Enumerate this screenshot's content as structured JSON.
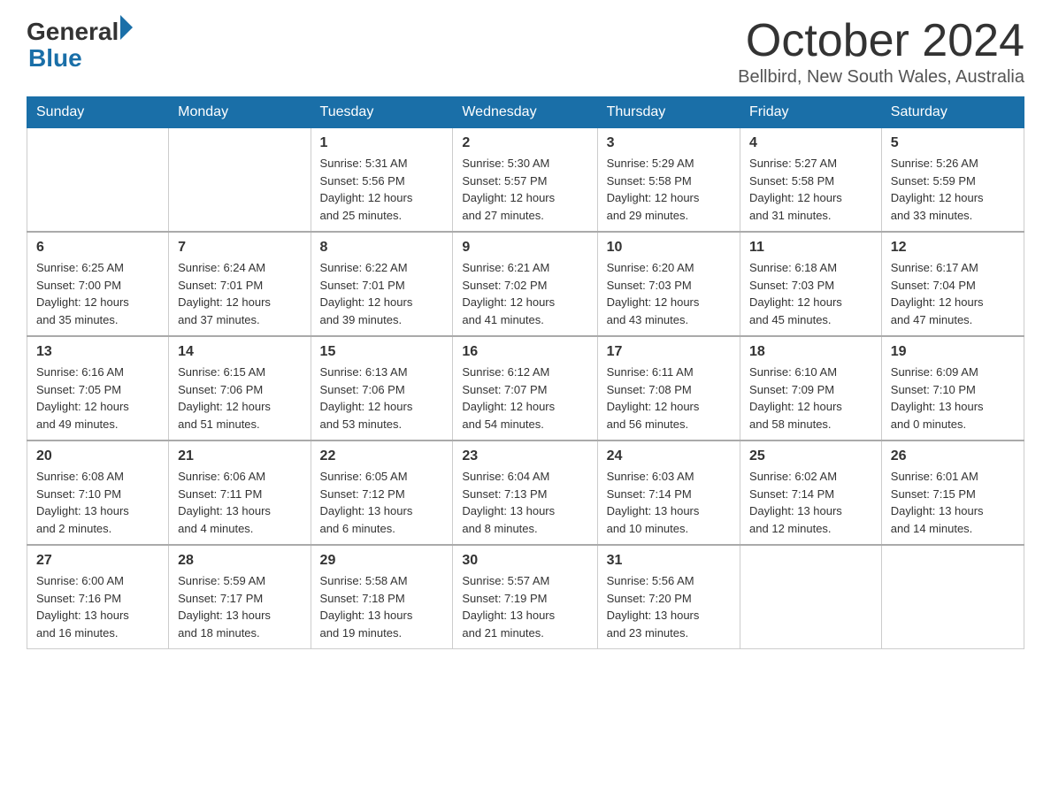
{
  "header": {
    "logo_general": "General",
    "logo_blue": "Blue",
    "month_title": "October 2024",
    "location": "Bellbird, New South Wales, Australia"
  },
  "days_of_week": [
    "Sunday",
    "Monday",
    "Tuesday",
    "Wednesday",
    "Thursday",
    "Friday",
    "Saturday"
  ],
  "weeks": [
    [
      {
        "day": "",
        "info": ""
      },
      {
        "day": "",
        "info": ""
      },
      {
        "day": "1",
        "info": "Sunrise: 5:31 AM\nSunset: 5:56 PM\nDaylight: 12 hours\nand 25 minutes."
      },
      {
        "day": "2",
        "info": "Sunrise: 5:30 AM\nSunset: 5:57 PM\nDaylight: 12 hours\nand 27 minutes."
      },
      {
        "day": "3",
        "info": "Sunrise: 5:29 AM\nSunset: 5:58 PM\nDaylight: 12 hours\nand 29 minutes."
      },
      {
        "day": "4",
        "info": "Sunrise: 5:27 AM\nSunset: 5:58 PM\nDaylight: 12 hours\nand 31 minutes."
      },
      {
        "day": "5",
        "info": "Sunrise: 5:26 AM\nSunset: 5:59 PM\nDaylight: 12 hours\nand 33 minutes."
      }
    ],
    [
      {
        "day": "6",
        "info": "Sunrise: 6:25 AM\nSunset: 7:00 PM\nDaylight: 12 hours\nand 35 minutes."
      },
      {
        "day": "7",
        "info": "Sunrise: 6:24 AM\nSunset: 7:01 PM\nDaylight: 12 hours\nand 37 minutes."
      },
      {
        "day": "8",
        "info": "Sunrise: 6:22 AM\nSunset: 7:01 PM\nDaylight: 12 hours\nand 39 minutes."
      },
      {
        "day": "9",
        "info": "Sunrise: 6:21 AM\nSunset: 7:02 PM\nDaylight: 12 hours\nand 41 minutes."
      },
      {
        "day": "10",
        "info": "Sunrise: 6:20 AM\nSunset: 7:03 PM\nDaylight: 12 hours\nand 43 minutes."
      },
      {
        "day": "11",
        "info": "Sunrise: 6:18 AM\nSunset: 7:03 PM\nDaylight: 12 hours\nand 45 minutes."
      },
      {
        "day": "12",
        "info": "Sunrise: 6:17 AM\nSunset: 7:04 PM\nDaylight: 12 hours\nand 47 minutes."
      }
    ],
    [
      {
        "day": "13",
        "info": "Sunrise: 6:16 AM\nSunset: 7:05 PM\nDaylight: 12 hours\nand 49 minutes."
      },
      {
        "day": "14",
        "info": "Sunrise: 6:15 AM\nSunset: 7:06 PM\nDaylight: 12 hours\nand 51 minutes."
      },
      {
        "day": "15",
        "info": "Sunrise: 6:13 AM\nSunset: 7:06 PM\nDaylight: 12 hours\nand 53 minutes."
      },
      {
        "day": "16",
        "info": "Sunrise: 6:12 AM\nSunset: 7:07 PM\nDaylight: 12 hours\nand 54 minutes."
      },
      {
        "day": "17",
        "info": "Sunrise: 6:11 AM\nSunset: 7:08 PM\nDaylight: 12 hours\nand 56 minutes."
      },
      {
        "day": "18",
        "info": "Sunrise: 6:10 AM\nSunset: 7:09 PM\nDaylight: 12 hours\nand 58 minutes."
      },
      {
        "day": "19",
        "info": "Sunrise: 6:09 AM\nSunset: 7:10 PM\nDaylight: 13 hours\nand 0 minutes."
      }
    ],
    [
      {
        "day": "20",
        "info": "Sunrise: 6:08 AM\nSunset: 7:10 PM\nDaylight: 13 hours\nand 2 minutes."
      },
      {
        "day": "21",
        "info": "Sunrise: 6:06 AM\nSunset: 7:11 PM\nDaylight: 13 hours\nand 4 minutes."
      },
      {
        "day": "22",
        "info": "Sunrise: 6:05 AM\nSunset: 7:12 PM\nDaylight: 13 hours\nand 6 minutes."
      },
      {
        "day": "23",
        "info": "Sunrise: 6:04 AM\nSunset: 7:13 PM\nDaylight: 13 hours\nand 8 minutes."
      },
      {
        "day": "24",
        "info": "Sunrise: 6:03 AM\nSunset: 7:14 PM\nDaylight: 13 hours\nand 10 minutes."
      },
      {
        "day": "25",
        "info": "Sunrise: 6:02 AM\nSunset: 7:14 PM\nDaylight: 13 hours\nand 12 minutes."
      },
      {
        "day": "26",
        "info": "Sunrise: 6:01 AM\nSunset: 7:15 PM\nDaylight: 13 hours\nand 14 minutes."
      }
    ],
    [
      {
        "day": "27",
        "info": "Sunrise: 6:00 AM\nSunset: 7:16 PM\nDaylight: 13 hours\nand 16 minutes."
      },
      {
        "day": "28",
        "info": "Sunrise: 5:59 AM\nSunset: 7:17 PM\nDaylight: 13 hours\nand 18 minutes."
      },
      {
        "day": "29",
        "info": "Sunrise: 5:58 AM\nSunset: 7:18 PM\nDaylight: 13 hours\nand 19 minutes."
      },
      {
        "day": "30",
        "info": "Sunrise: 5:57 AM\nSunset: 7:19 PM\nDaylight: 13 hours\nand 21 minutes."
      },
      {
        "day": "31",
        "info": "Sunrise: 5:56 AM\nSunset: 7:20 PM\nDaylight: 13 hours\nand 23 minutes."
      },
      {
        "day": "",
        "info": ""
      },
      {
        "day": "",
        "info": ""
      }
    ]
  ]
}
